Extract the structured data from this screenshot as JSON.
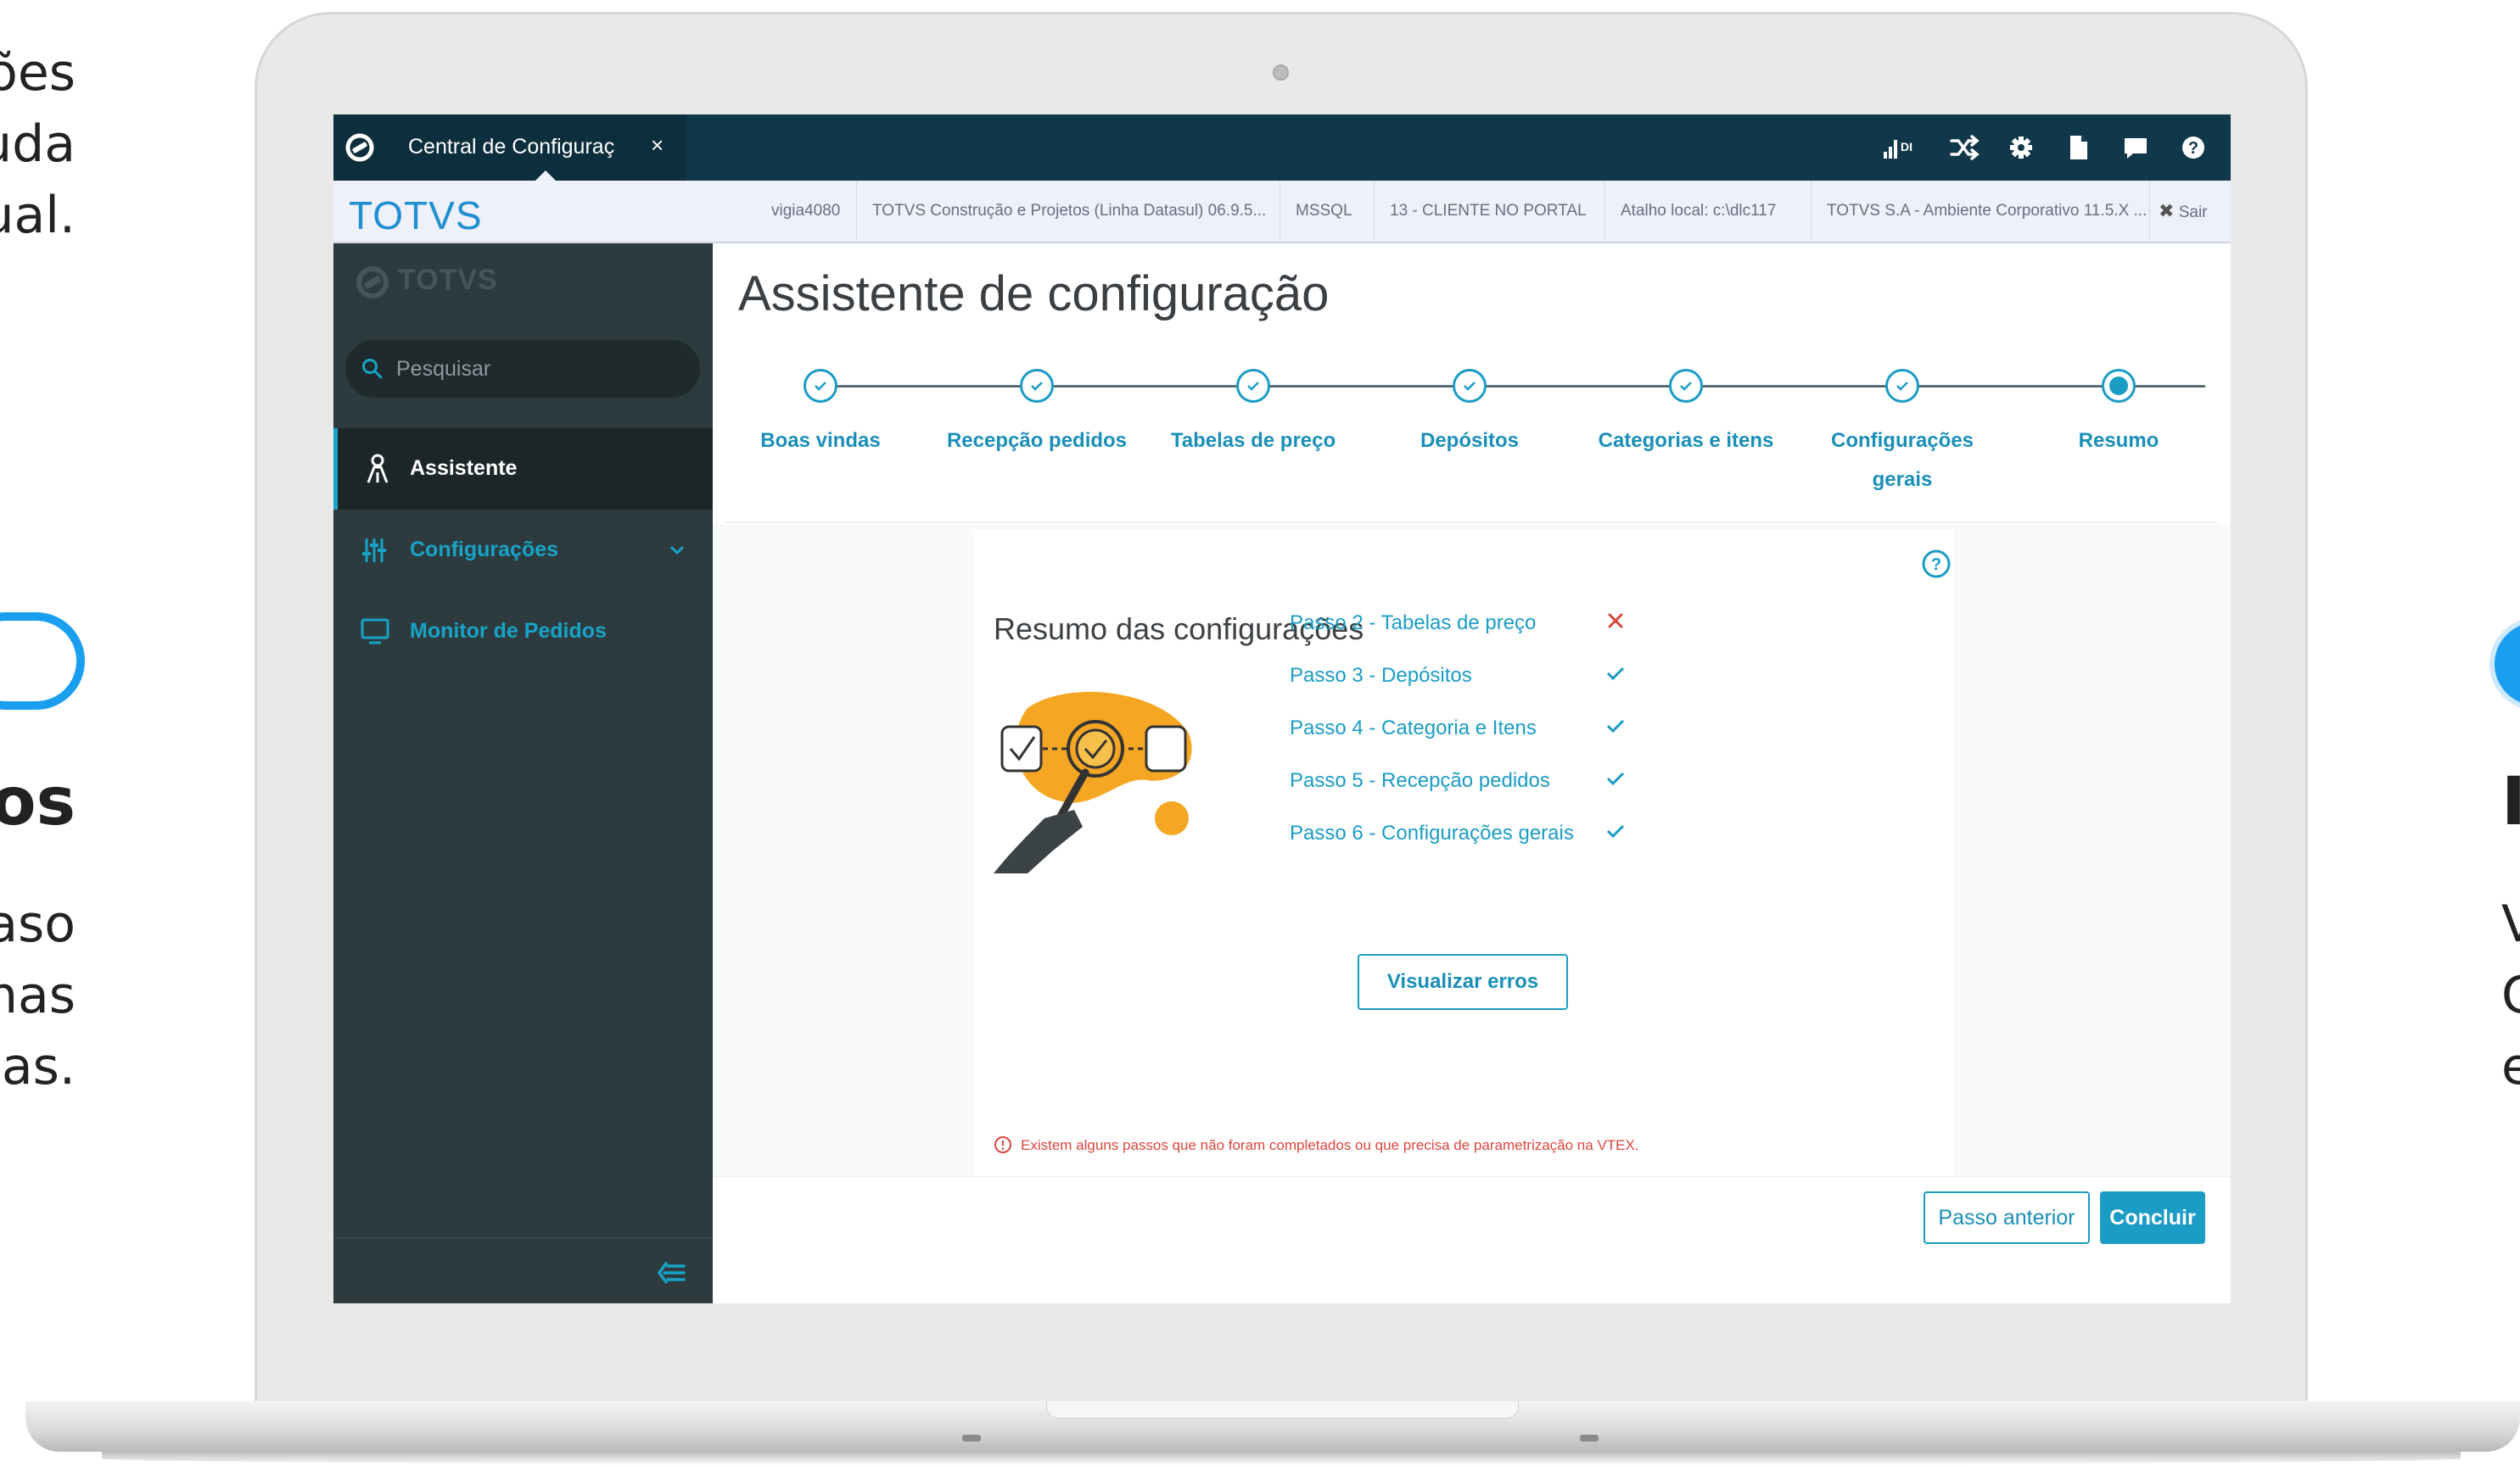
{
  "left_text": {
    "line1": "ões",
    "line2": "uda",
    "line3": "ual.",
    "heading": "os",
    "line4": "aso",
    "line5": "nas",
    "line6": "as."
  },
  "right_text": {
    "heading": "I",
    "line1": "V",
    "line2": "C",
    "line3": "e"
  },
  "app": {
    "tab_title": "Central de Configuraç",
    "tab_close": "×",
    "brand": "TOTVS",
    "header_icons": [
      "signal-icon",
      "shuffle-icon",
      "gear-icon",
      "document-icon",
      "chat-icon",
      "help-icon"
    ],
    "signal_label": "DI",
    "info_bar": {
      "user": "vigia4080",
      "product": "TOTVS Construção e Projetos (Linha Datasul) 06.9.5...",
      "database": "MSSQL",
      "company": "13 - CLIENTE NO PORTAL",
      "shortcut": "Atalho local: c:\\dlc117",
      "environment": "TOTVS S.A - Ambiente Corporativo 11.5.X ...",
      "exit": "Sair"
    }
  },
  "sidebar": {
    "logo_text": "TOTVS",
    "search_placeholder": "Pesquisar",
    "items": [
      {
        "label": "Assistente",
        "icon": "wizard-icon",
        "active": true
      },
      {
        "label": "Configurações",
        "icon": "sliders-icon",
        "expandable": true
      },
      {
        "label": "Monitor de Pedidos",
        "icon": "monitor-icon"
      }
    ]
  },
  "main": {
    "title": "Assistente de configuração",
    "steps": [
      {
        "label": "Boas vindas",
        "state": "done"
      },
      {
        "label": "Recepção pedidos",
        "state": "done"
      },
      {
        "label": "Tabelas de preço",
        "state": "done"
      },
      {
        "label": "Depósitos",
        "state": "done"
      },
      {
        "label": "Categorias e itens",
        "state": "done"
      },
      {
        "label": "Configurações gerais",
        "state": "done"
      },
      {
        "label": "Resumo",
        "state": "current"
      }
    ],
    "summary": {
      "title": "Resumo das configurações",
      "items": [
        {
          "label": "Passo 2 - Tabelas de preço",
          "status": "error"
        },
        {
          "label": "Passo 3 - Depósitos",
          "status": "ok"
        },
        {
          "label": "Passo 4 - Categoria e Itens",
          "status": "ok"
        },
        {
          "label": "Passo 5 - Recepção pedidos",
          "status": "ok"
        },
        {
          "label": "Passo 6 - Configurações gerais",
          "status": "ok"
        }
      ],
      "view_errors_button": "Visualizar erros",
      "warning": "Existem alguns passos que não foram completados ou que precisa de parametrização na VTEX."
    },
    "prev_button": "Passo anterior",
    "finish_button": "Concluir"
  },
  "colors": {
    "accent": "#1a9cc4",
    "topbar": "#11384a",
    "sidebar": "#2d3b3e",
    "error": "#d9463c",
    "illustration": "#f5a623"
  }
}
